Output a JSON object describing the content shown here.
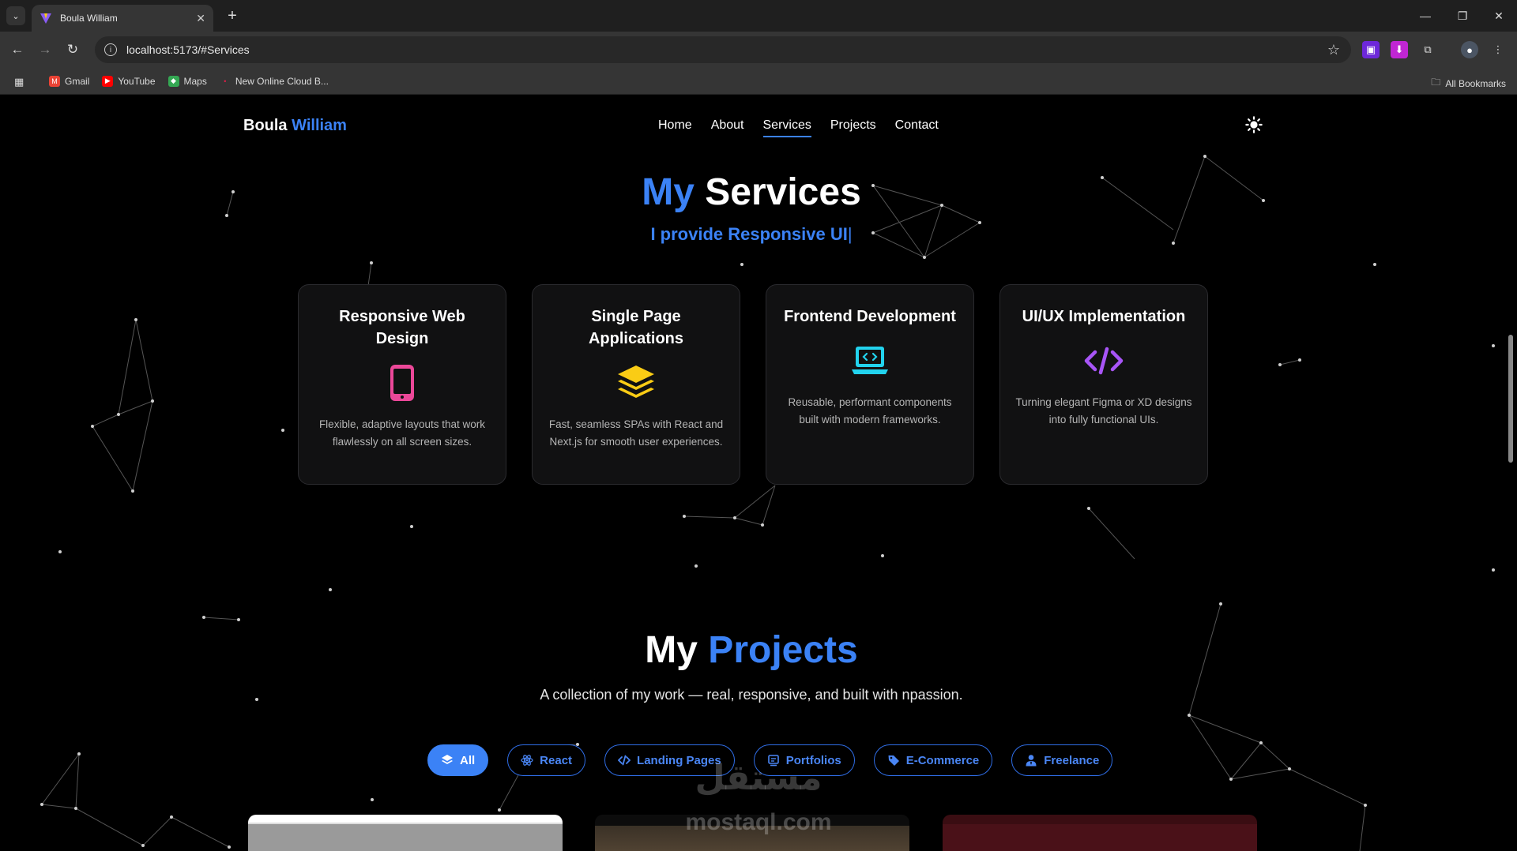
{
  "browser": {
    "tab_title": "Boula William",
    "url": "localhost:5173/#Services",
    "bookmarks": [
      "Gmail",
      "YouTube",
      "Maps",
      "New Online Cloud B..."
    ],
    "all_bookmarks": "All Bookmarks"
  },
  "site": {
    "brand_first": "Boula",
    "brand_last": "William",
    "nav": [
      "Home",
      "About",
      "Services",
      "Projects",
      "Contact"
    ],
    "active_nav": "Services"
  },
  "services": {
    "title_accent": "My",
    "title_rest": "Services",
    "subtitle": "I provide Responsive UI",
    "cursor": "|",
    "cards": [
      {
        "title": "Responsive Web Design",
        "icon": "mobile-icon",
        "color": "#ec4899",
        "desc": "Flexible, adaptive layouts that work flawlessly on all screen sizes."
      },
      {
        "title": "Single Page Applications",
        "icon": "layers-icon",
        "color": "#facc15",
        "desc": "Fast, seamless SPAs with React and Next.js for smooth user experiences."
      },
      {
        "title": "Frontend Development",
        "icon": "laptop-code-icon",
        "color": "#22d3ee",
        "desc": "Reusable, performant components built with modern frameworks."
      },
      {
        "title": "UI/UX Implementation",
        "icon": "code-icon",
        "color": "#a855f7",
        "desc": "Turning elegant Figma or XD designs into fully functional UIs."
      }
    ]
  },
  "projects": {
    "title_plain": "My",
    "title_accent": "Projects",
    "subtitle": "A collection of my work — real, responsive, and built with npassion.",
    "filters": [
      "All",
      "React",
      "Landing Pages",
      "Portfolios",
      "E-Commerce",
      "Freelance"
    ],
    "active_filter": "All"
  },
  "watermark": {
    "arabic": "مستقل",
    "latin": "mostaql.com"
  },
  "colors": {
    "accent": "#3b82f6",
    "background": "#000000"
  }
}
